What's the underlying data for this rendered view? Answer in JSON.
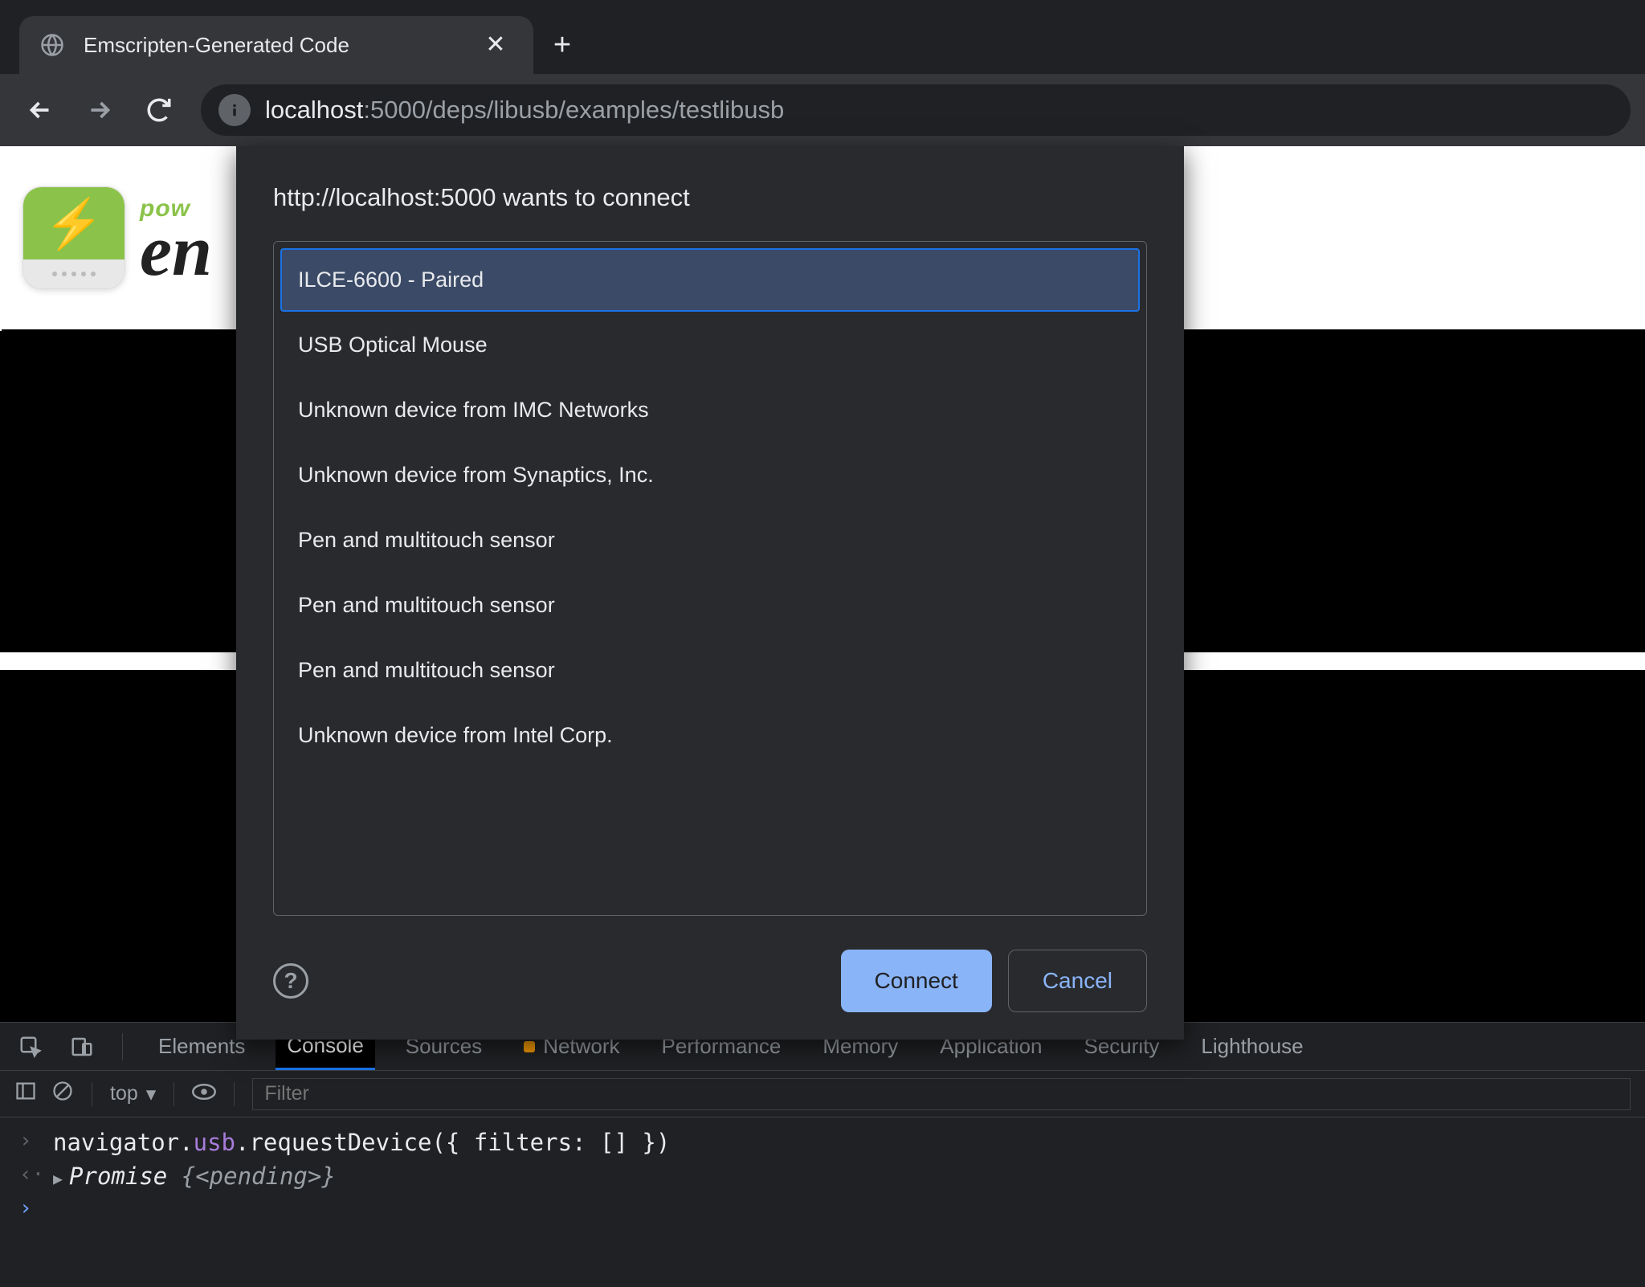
{
  "tab": {
    "title": "Emscripten-Generated Code"
  },
  "url": {
    "host": "localhost",
    "path": ":5000/deps/libusb/examples/testlibusb"
  },
  "brand": {
    "pow": "pow",
    "en": "en"
  },
  "dialog": {
    "title": "http://localhost:5000 wants to connect",
    "devices": [
      "ILCE-6600 - Paired",
      "USB Optical Mouse",
      "Unknown device from IMC Networks",
      "Unknown device from Synaptics, Inc.",
      "Pen and multitouch sensor",
      "Pen and multitouch sensor",
      "Pen and multitouch sensor",
      "Unknown device from Intel Corp."
    ],
    "connect": "Connect",
    "cancel": "Cancel"
  },
  "devtools": {
    "tabs": {
      "elements": "Elements",
      "console": "Console",
      "sources": "Sources",
      "network": "Network",
      "performance": "Performance",
      "memory": "Memory",
      "application": "Application",
      "security": "Security",
      "lighthouse": "Lighthouse"
    },
    "context": "top",
    "filter_placeholder": "Filter",
    "lines": {
      "input": "navigator.usb.requestDevice({ filters: [] })",
      "output_prefix": "Promise ",
      "output_state": "{<pending>}"
    }
  }
}
